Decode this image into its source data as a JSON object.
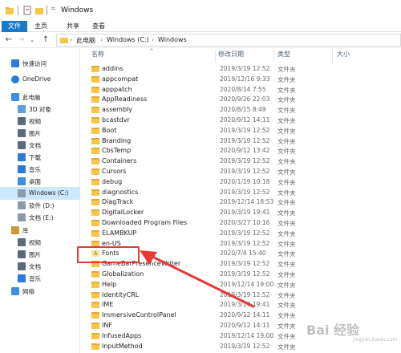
{
  "window": {
    "title": "Windows"
  },
  "ribbon": {
    "tabs": [
      "文件",
      "主页",
      "共享",
      "查看"
    ]
  },
  "address": {
    "crumbs": [
      "此电脑",
      "Windows (C:)",
      "Windows"
    ]
  },
  "columns": {
    "name": "名称",
    "date": "修改日期",
    "type": "类型",
    "size": "大小"
  },
  "nav": {
    "items": [
      {
        "label": "快速访问",
        "icon": "star-icon"
      },
      {
        "label": "OneDrive",
        "icon": "cloud-icon"
      },
      {
        "label": "此电脑",
        "icon": "pc-icon"
      },
      {
        "label": "3D 对象",
        "icon": "cube-icon"
      },
      {
        "label": "视频",
        "icon": "video-icon"
      },
      {
        "label": "图片",
        "icon": "picture-icon"
      },
      {
        "label": "文档",
        "icon": "document-icon"
      },
      {
        "label": "下载",
        "icon": "download-icon"
      },
      {
        "label": "音乐",
        "icon": "music-icon"
      },
      {
        "label": "桌面",
        "icon": "desktop-icon"
      },
      {
        "label": "Windows (C:)",
        "icon": "drive-icon"
      },
      {
        "label": "软件 (D:)",
        "icon": "drive-icon"
      },
      {
        "label": "文档 (E:)",
        "icon": "drive-icon"
      },
      {
        "label": "库",
        "icon": "library-icon"
      },
      {
        "label": "视频",
        "icon": "video-icon"
      },
      {
        "label": "图片",
        "icon": "picture-icon"
      },
      {
        "label": "文档",
        "icon": "document-icon"
      },
      {
        "label": "音乐",
        "icon": "music-icon"
      },
      {
        "label": "网络",
        "icon": "network-icon"
      }
    ],
    "selected_index": 10
  },
  "files": [
    {
      "name": "addins",
      "date": "2019/3/19 12:52",
      "type": "文件夹"
    },
    {
      "name": "appcompat",
      "date": "2019/12/16 9:33",
      "type": "文件夹"
    },
    {
      "name": "apppatch",
      "date": "2020/8/14 7:55",
      "type": "文件夹"
    },
    {
      "name": "AppReadiness",
      "date": "2020/9/26 22:03",
      "type": "文件夹"
    },
    {
      "name": "assembly",
      "date": "2020/8/15 8:49",
      "type": "文件夹"
    },
    {
      "name": "bcastdvr",
      "date": "2020/9/12 14:11",
      "type": "文件夹"
    },
    {
      "name": "Boot",
      "date": "2019/3/19 12:52",
      "type": "文件夹"
    },
    {
      "name": "Branding",
      "date": "2019/3/19 12:52",
      "type": "文件夹"
    },
    {
      "name": "CbsTemp",
      "date": "2020/9/12 13:42",
      "type": "文件夹"
    },
    {
      "name": "Containers",
      "date": "2019/3/19 12:52",
      "type": "文件夹"
    },
    {
      "name": "Cursors",
      "date": "2019/3/19 12:52",
      "type": "文件夹"
    },
    {
      "name": "debug",
      "date": "2020/1/19 10:18",
      "type": "文件夹"
    },
    {
      "name": "diagnostics",
      "date": "2019/3/19 12:52",
      "type": "文件夹"
    },
    {
      "name": "DiagTrack",
      "date": "2019/12/14 18:53",
      "type": "文件夹"
    },
    {
      "name": "DigitalLocker",
      "date": "2019/3/19 19:41",
      "type": "文件夹"
    },
    {
      "name": "Downloaded Program Files",
      "date": "2020/3/27 10:16",
      "type": "文件夹"
    },
    {
      "name": "ELAMBKUP",
      "date": "2019/3/19 12:52",
      "type": "文件夹"
    },
    {
      "name": "en-US",
      "date": "2019/3/19 12:52",
      "type": "文件夹"
    },
    {
      "name": "Fonts",
      "date": "2020/7/4 15:40",
      "type": "文件夹"
    },
    {
      "name": "GameBarPresenceWriter",
      "date": "2019/3/19 12:52",
      "type": "文件夹"
    },
    {
      "name": "Globalization",
      "date": "2019/3/19 12:52",
      "type": "文件夹"
    },
    {
      "name": "Help",
      "date": "2019/12/14 19:00",
      "type": "文件夹"
    },
    {
      "name": "IdentityCRL",
      "date": "2019/3/19 12:52",
      "type": "文件夹"
    },
    {
      "name": "IME",
      "date": "2019/3/19 19:41",
      "type": "文件夹"
    },
    {
      "name": "ImmersiveControlPanel",
      "date": "2020/9/12 14:11",
      "type": "文件夹"
    },
    {
      "name": "INF",
      "date": "2020/9/12 14:11",
      "type": "文件夹"
    },
    {
      "name": "InfusedApps",
      "date": "2019/12/14 19:00",
      "type": "文件夹"
    },
    {
      "name": "InputMethod",
      "date": "2019/3/19 12:52",
      "type": "文件夹"
    }
  ],
  "watermark": {
    "text": "Bai 经验",
    "sub": "jingyan.baidu.com"
  },
  "colors": {
    "accent": "#1979ca",
    "folder": "#f8c54b",
    "highlight": "#e53935",
    "selected_bg": "#cce8ff"
  }
}
